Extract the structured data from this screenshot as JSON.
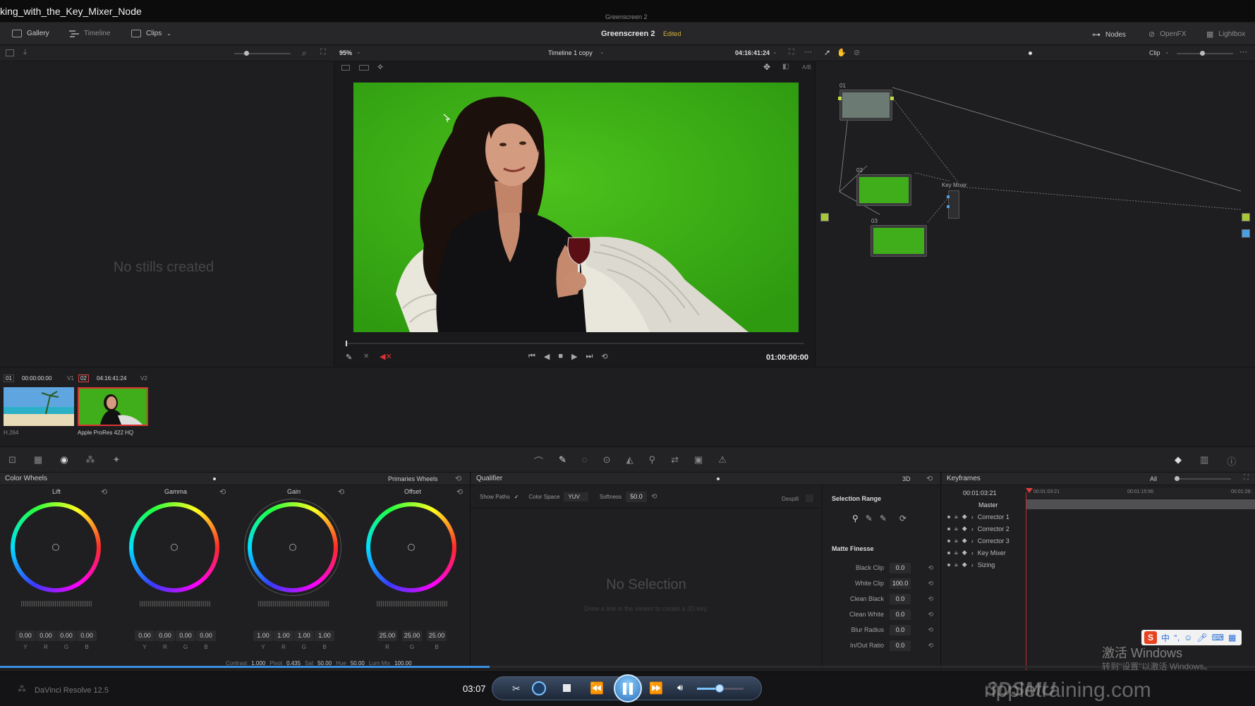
{
  "window": {
    "video_name": "king_with_the_Key_Mixer_Node",
    "project_center": "Greenscreen 2"
  },
  "menu": {
    "gallery": "Gallery",
    "timeline": "Timeline",
    "clips": "Clips",
    "project_title": "Greenscreen 2",
    "status": "Edited",
    "nodes": "Nodes",
    "openfx": "OpenFX",
    "lightbox": "Lightbox"
  },
  "toolbar": {
    "zoom": "95%",
    "timeline_name": "Timeline 1 copy",
    "timecode": "04:16:41:24",
    "clip_mode": "Clip"
  },
  "gallery": {
    "empty_text": "No stills created"
  },
  "viewer": {
    "ab_label": "A/B",
    "playhead_time": "01:00:00:00"
  },
  "nodes": {
    "node1_label": "01",
    "node2_label": "02",
    "node3_label": "03",
    "keymixer_label": "Key Mixer"
  },
  "clips": {
    "clip1_num": "01",
    "clip1_tc": "00:00:00:00",
    "clip1_track": "V1",
    "clip1_codec": "H.264",
    "clip2_num": "02",
    "clip2_tc": "04:16:41:24",
    "clip2_track": "V2",
    "clip2_codec": "Apple ProRes 422 HQ"
  },
  "color_wheels": {
    "title": "Color Wheels",
    "mode": "Primaries Wheels",
    "wheels": [
      {
        "name": "Lift",
        "values": [
          "0.00",
          "0.00",
          "0.00",
          "0.00"
        ],
        "channels": [
          "Y",
          "R",
          "G",
          "B"
        ]
      },
      {
        "name": "Gamma",
        "values": [
          "0.00",
          "0.00",
          "0.00",
          "0.00"
        ],
        "channels": [
          "Y",
          "R",
          "G",
          "B"
        ]
      },
      {
        "name": "Gain",
        "values": [
          "1.00",
          "1.00",
          "1.00",
          "1.00"
        ],
        "channels": [
          "Y",
          "R",
          "G",
          "B"
        ]
      },
      {
        "name": "Offset",
        "values": [
          "25.00",
          "25.00",
          "25.00"
        ],
        "channels": [
          "R",
          "G",
          "B"
        ]
      }
    ],
    "bottom": {
      "contrast_label": "Contrast",
      "contrast": "1.000",
      "pivot_label": "Pivot",
      "pivot": "0.435",
      "sat_label": "Sat",
      "sat": "50.00",
      "hue_label": "Hue",
      "hue": "50.00",
      "lummix_label": "Lum Mix",
      "lummix": "100.00"
    }
  },
  "qualifier": {
    "title": "Qualifier",
    "mode": "3D",
    "show_paths": "Show Paths",
    "color_space_label": "Color Space",
    "color_space": "YUV",
    "softness_label": "Softness",
    "softness": "50.0",
    "despill": "Despill",
    "no_selection": "No Selection",
    "hint": "Draw a line in the viewer to create a 3D key.",
    "selection_range": "Selection Range",
    "matte_finesse": "Matte Finesse",
    "matte": [
      {
        "label": "Black Clip",
        "value": "0.0"
      },
      {
        "label": "White Clip",
        "value": "100.0"
      },
      {
        "label": "Clean Black",
        "value": "0.0"
      },
      {
        "label": "Clean White",
        "value": "0.0"
      },
      {
        "label": "Blur Radius",
        "value": "0.0"
      },
      {
        "label": "In/Out Ratio",
        "value": "0.0"
      }
    ]
  },
  "keyframes": {
    "title": "Keyframes",
    "filter": "All",
    "current_tc": "00:01:03:21",
    "ruler": [
      "00:01:03:21",
      "00:01:15:56",
      "00:01:28:"
    ],
    "tracks": [
      "Master",
      "Corrector 1",
      "Corrector 2",
      "Corrector 3",
      "Key Mixer",
      "Sizing"
    ]
  },
  "player": {
    "app_name": "DaVinci Resolve 12.5",
    "time": "03:07",
    "progress": 0.39,
    "volume": 0.48
  },
  "watermark": {
    "activate_title": "激活 Windows",
    "activate_sub": "转到\"设置\"以激活 Windows。",
    "brand": "3DSMU",
    "site": "rippletraining.com",
    "ime": "中"
  }
}
